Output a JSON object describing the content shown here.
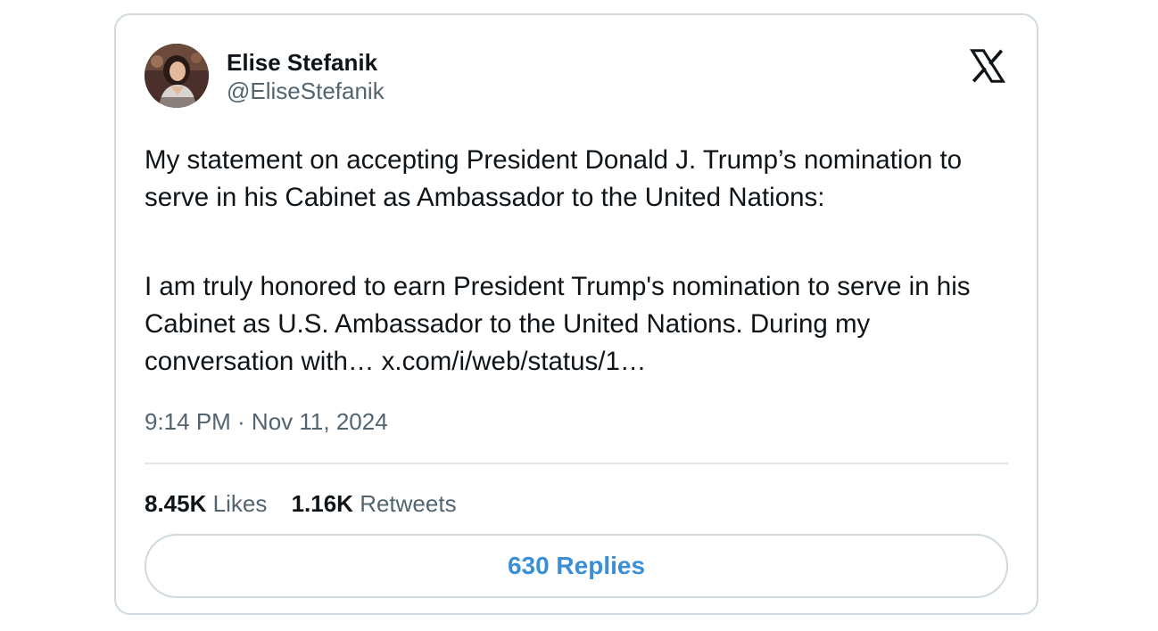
{
  "tweet": {
    "author_name": "Elise Stefanik",
    "author_handle": "@EliseStefanik",
    "brand_logo": "x-logo-icon",
    "paragraph_1": "My statement on accepting President Donald J. Trump’s nomination to serve in his Cabinet as Ambassador to the United Nations:",
    "paragraph_2_text": "I am truly honored to earn President Trump's nomination to serve in his Cabinet as U.S. Ambassador to the United Nations. During my conversation with…",
    "paragraph_2_link": "x.com/i/web/status/1…",
    "timestamp": "9:14 PM · Nov 11, 2024",
    "likes_count": "8.45K",
    "likes_label": "Likes",
    "retweets_count": "1.16K",
    "retweets_label": "Retweets",
    "replies_button": "630 Replies"
  },
  "colors": {
    "text_primary": "#0f1419",
    "text_secondary": "#536471",
    "border": "#cfd9de",
    "accent": "#3b8fd6"
  }
}
